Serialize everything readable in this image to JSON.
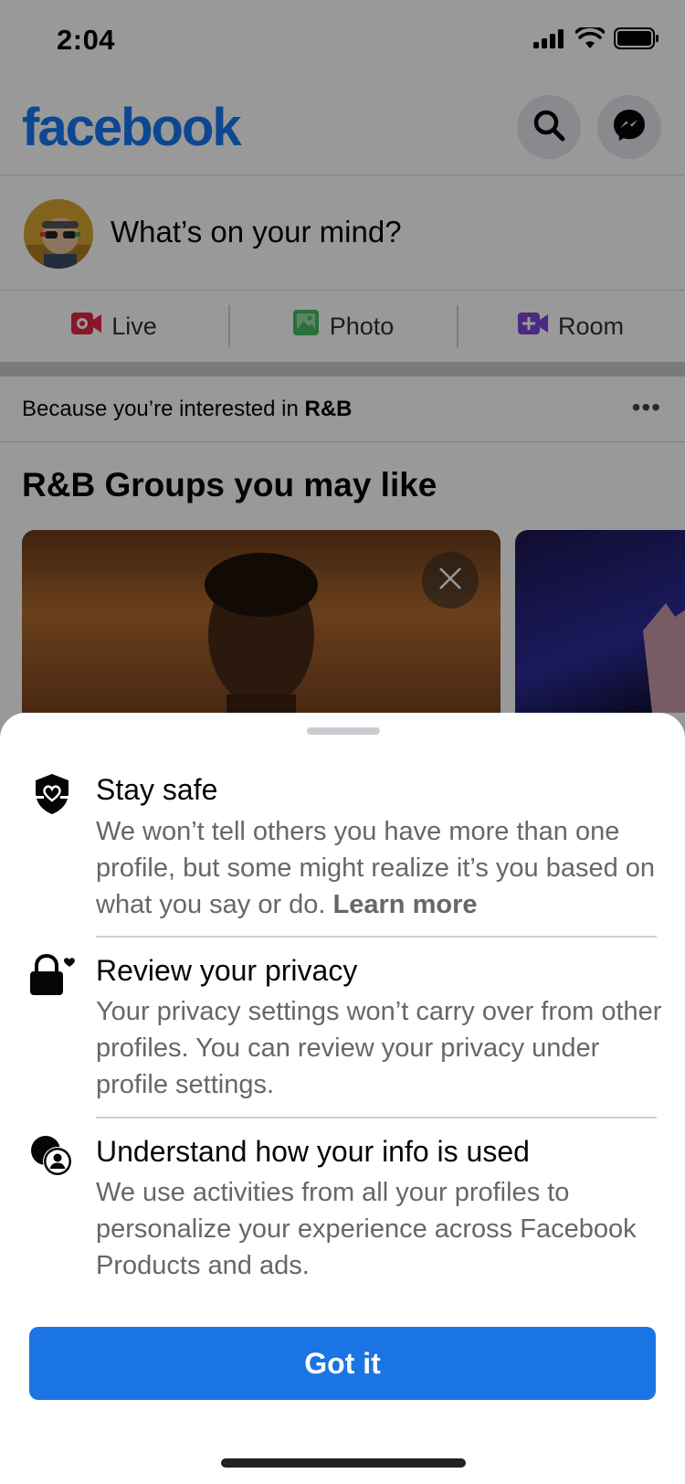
{
  "status_bar": {
    "time": "2:04"
  },
  "header": {
    "logo": "facebook",
    "search_icon": "search-icon",
    "messenger_icon": "messenger-icon",
    "brand_color": "#1877f2"
  },
  "composer": {
    "placeholder": "What’s on your mind?"
  },
  "actions": [
    {
      "label": "Live",
      "icon": "live-video-icon",
      "color": "#e42645"
    },
    {
      "label": "Photo",
      "icon": "photo-icon",
      "color": "#45bd62"
    },
    {
      "label": "Room",
      "icon": "room-icon",
      "color": "#7c48d8"
    }
  ],
  "interest": {
    "prefix": "Because you’re interested in ",
    "topic": "R&B"
  },
  "groups": {
    "title": "R&B Groups you may like"
  },
  "sheet": {
    "items": [
      {
        "title": "Stay safe",
        "body": "We won’t tell others you have more than one profile, but some might realize it’s you based on what you say or do.",
        "link": "Learn more",
        "icon": "shield-heart-icon"
      },
      {
        "title": "Review your privacy",
        "body": "Your privacy settings won’t carry over from other profiles. You can review your privacy under profile settings.",
        "icon": "lock-heart-icon"
      },
      {
        "title": "Understand how your info is used",
        "body": "We use activities from all your profiles to personalize your experience across Facebook Products and ads.",
        "icon": "profiles-icon"
      }
    ],
    "button_label": "Got it",
    "button_color": "#1b74e4"
  }
}
